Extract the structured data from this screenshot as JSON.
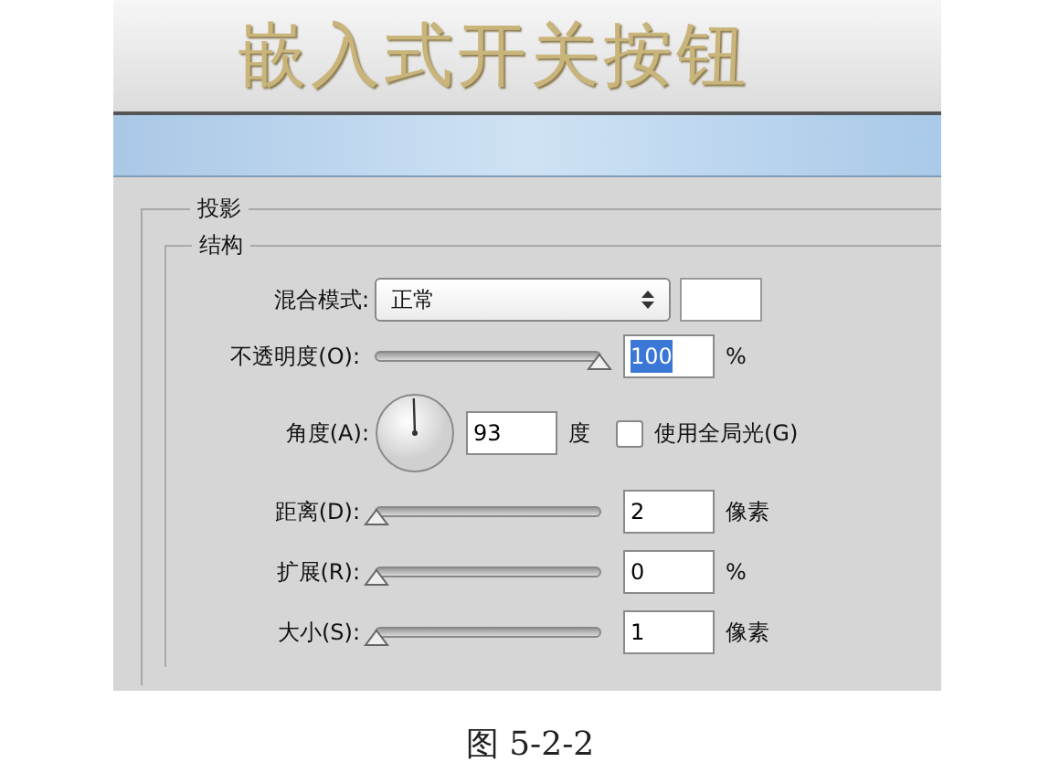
{
  "banner": {
    "title": "嵌入式开关按钮"
  },
  "dialog": {
    "section": "投影",
    "group": "结构",
    "blend_mode": {
      "label": "混合模式:",
      "value": "正常"
    },
    "opacity": {
      "label": "不透明度(O):",
      "level": 1,
      "value": "100",
      "highlighted": true,
      "unit": "%"
    },
    "angle": {
      "label": "角度(A):",
      "value": "93",
      "unit": "度",
      "global_light": {
        "label": "使用全局光(G)",
        "checked": false
      }
    },
    "sliders": [
      {
        "label": "距离(D):",
        "level": 0,
        "value": "2",
        "unit": "像素"
      },
      {
        "label": "扩展(R):",
        "level": 0,
        "value": "0",
        "unit": "%"
      },
      {
        "label": "大小(S):",
        "level": 0,
        "value": "1",
        "unit": "像素"
      }
    ]
  },
  "caption": "图 5-2-2"
}
